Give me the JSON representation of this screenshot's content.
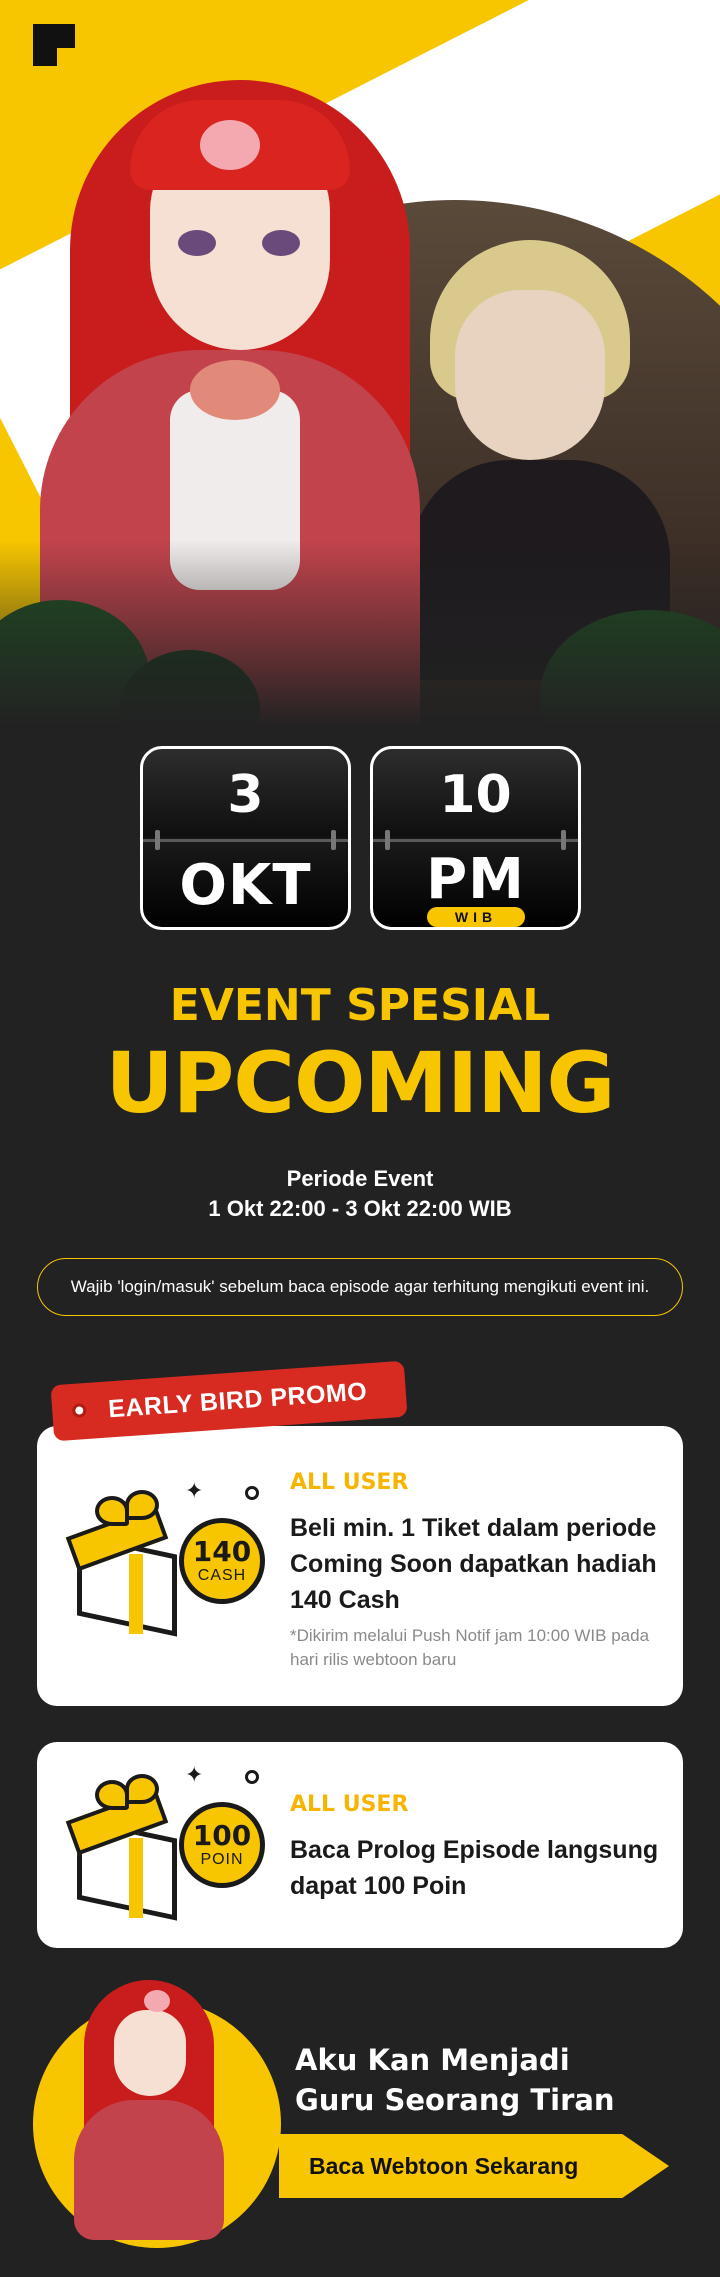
{
  "date": {
    "day": "3",
    "month": "OKT",
    "hour": "10",
    "meridiem": "PM",
    "timezone": "WIB"
  },
  "event": {
    "title": "EVENT SPESIAL",
    "subtitle": "UPCOMING",
    "period_label": "Periode Event",
    "period_range": "1 Okt 22:00 - 3 Okt 22:00 WIB",
    "notice": "Wajib 'login/masuk' sebelum baca episode agar terhitung mengikuti event ini."
  },
  "promo": {
    "tag": "EARLY BIRD PROMO",
    "cards": [
      {
        "audience": "ALL USER",
        "description": "Beli min. 1 Tiket dalam periode Coming Soon dapatkan hadiah 140 Cash",
        "note": "*Dikirim melalui Push Notif jam 10:00 WIB pada hari rilis webtoon baru",
        "reward_amount": "140",
        "reward_unit": "CASH"
      },
      {
        "audience": "ALL USER",
        "description": "Baca Prolog Episode langsung dapat 100 Poin",
        "reward_amount": "100",
        "reward_unit": "POIN"
      }
    ]
  },
  "cta": {
    "title_line1": "Aku Kan Menjadi",
    "title_line2": "Guru Seorang Tiran",
    "button_label": "Baca Webtoon Sekarang"
  },
  "colors": {
    "accent": "#f7c600",
    "background": "#222222",
    "promo_red": "#d72b22",
    "card": "#ffffff"
  },
  "icons": [
    "brand-logo-icon",
    "gift-box-icon",
    "coin-icon",
    "sparkle-icon"
  ]
}
